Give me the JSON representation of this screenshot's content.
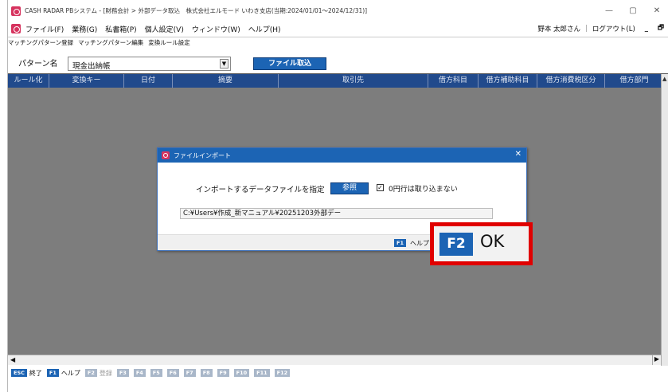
{
  "titlebar": {
    "title": "CASH RADAR PBシステム - [財務会計 > 外部データ取込　株式会社エルモード いわき支店(当期:2024/01/01〜2024/12/31)]",
    "minimize": "—",
    "maximize": "▢",
    "close": "✕"
  },
  "menubar": {
    "items": [
      "ファイル(F)",
      "業務(G)",
      "私書箱(P)",
      "個人設定(V)",
      "ウィンドウ(W)",
      "ヘルプ(H)"
    ],
    "user": "野本 太郎さん",
    "logout": "ログアウト(L)",
    "ctrl_min": "_",
    "ctrl_restore": "🗗"
  },
  "subtabs": [
    "マッチングパターン登録",
    "マッチングパターン編集",
    "変換ルール設定"
  ],
  "pattern": {
    "label": "パターン名",
    "value": "現金出納帳",
    "import_button": "ファイル取込"
  },
  "grid": {
    "columns": [
      "ルール化",
      "変換キー",
      "日付",
      "摘要",
      "取引先",
      "借方科目",
      "借方補助科目",
      "借方消費税区分",
      "借方部門"
    ]
  },
  "fkeys": [
    {
      "key": "ESC",
      "label": "終了",
      "enabled": true
    },
    {
      "key": "F1",
      "label": "ヘルプ",
      "enabled": true
    },
    {
      "key": "F2",
      "label": "登録",
      "enabled": false
    },
    {
      "key": "F3",
      "label": "",
      "enabled": false
    },
    {
      "key": "F4",
      "label": "",
      "enabled": false
    },
    {
      "key": "F5",
      "label": "",
      "enabled": false
    },
    {
      "key": "F6",
      "label": "",
      "enabled": false
    },
    {
      "key": "F7",
      "label": "",
      "enabled": false
    },
    {
      "key": "F8",
      "label": "",
      "enabled": false
    },
    {
      "key": "F9",
      "label": "",
      "enabled": false
    },
    {
      "key": "F10",
      "label": "",
      "enabled": false
    },
    {
      "key": "F11",
      "label": "",
      "enabled": false
    },
    {
      "key": "F12",
      "label": "",
      "enabled": false
    }
  ],
  "dialog": {
    "title": "ファイルインポート",
    "close": "✕",
    "prompt": "インポートするデータファイルを指定",
    "browse_button": "参照",
    "checkbox_checked": true,
    "checkbox_mark": "✓",
    "checkbox_label": "0円行は取り込まない",
    "file_path": "C:¥Users¥作成_新マニュアル¥20251203外部デー",
    "f1_key": "F1",
    "f1_label": "ヘルプ"
  },
  "callout": {
    "key": "F2",
    "label": "OK",
    "border_color": "#e00000"
  },
  "colors": {
    "accent": "#1c64b4",
    "header": "#214a8c",
    "grid_bg": "#7d7d7d",
    "brand": "#d6335e"
  }
}
